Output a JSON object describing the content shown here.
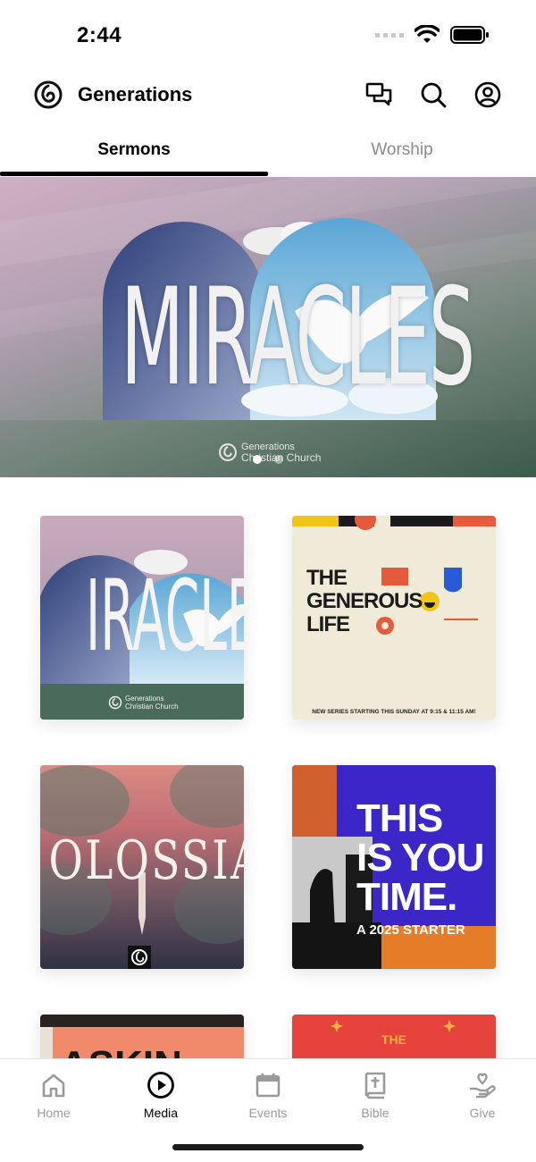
{
  "status_bar": {
    "time": "2:44"
  },
  "header": {
    "title": "Generations"
  },
  "tabs": [
    {
      "label": "Sermons",
      "active": true
    },
    {
      "label": "Worship",
      "active": false
    }
  ],
  "hero": {
    "title": "MIRACLES",
    "brand_line1": "Generations",
    "brand_line2": "Christian Church",
    "slides": 2,
    "active_slide": 1
  },
  "grid": {
    "cards": [
      {
        "title": "IRACLE",
        "brand_line1": "Generations",
        "brand_line2": "Christian Church"
      },
      {
        "lines": [
          "THE",
          "GENEROUS",
          "LIFE"
        ],
        "caption": "NEW SERIES STARTING THIS SUNDAY AT 9:15 & 11:15 AM!"
      },
      {
        "title": "OLOSSIA"
      },
      {
        "lines": [
          "THIS",
          "IS YOU",
          "TIME."
        ],
        "sub": "A 2025 STARTER"
      },
      {
        "title": "ASKIN"
      },
      {
        "title": "THE"
      }
    ]
  },
  "bottom_nav": {
    "items": [
      {
        "label": "Home",
        "icon": "home-icon",
        "active": false
      },
      {
        "label": "Media",
        "icon": "play-circle-icon",
        "active": true
      },
      {
        "label": "Events",
        "icon": "calendar-icon",
        "active": false
      },
      {
        "label": "Bible",
        "icon": "bible-icon",
        "active": false
      },
      {
        "label": "Give",
        "icon": "give-heart-hand-icon",
        "active": false
      }
    ]
  },
  "colors": {
    "active_text": "#000000",
    "inactive_text": "#8a8a8a",
    "generous_red": "#e55a3a"
  }
}
